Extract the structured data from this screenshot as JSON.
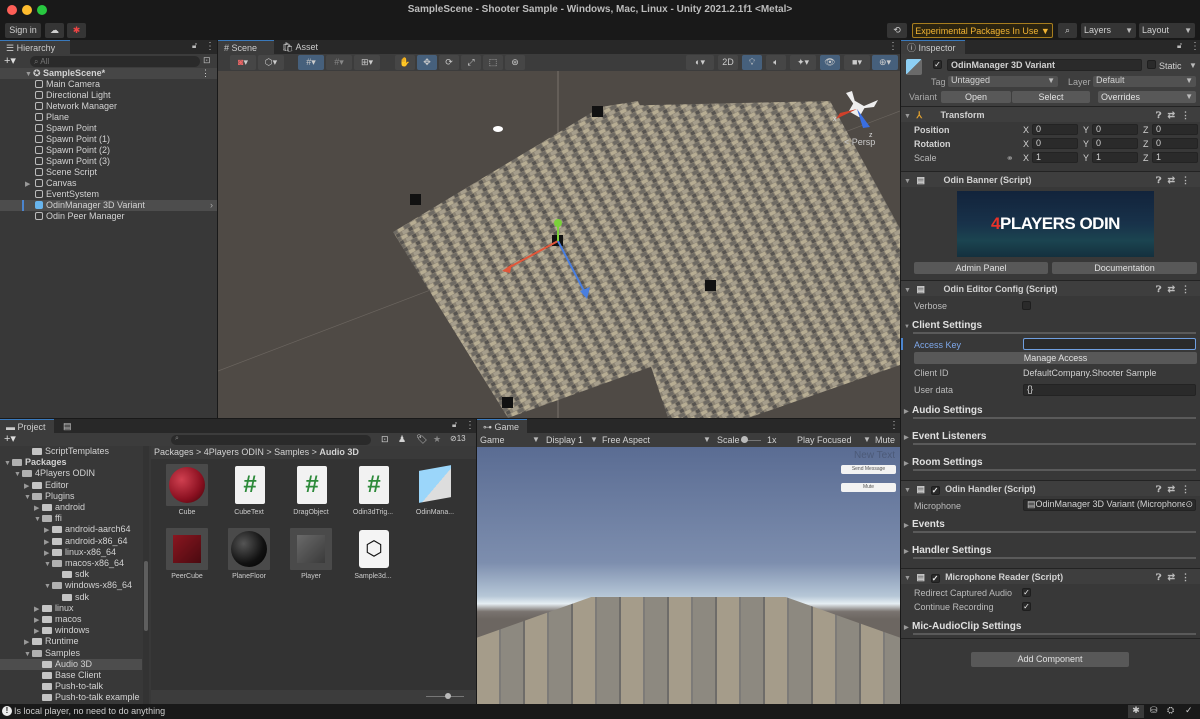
{
  "window": {
    "title": "SampleScene - Shooter Sample - Windows, Mac, Linux - Unity 2021.2.1f1 <Metal>"
  },
  "toolbar": {
    "sign_in": "Sign in",
    "cloud_icon": "cloud-icon",
    "collab_icon": "collab-icon",
    "play_icon": "▶",
    "pause_icon": "❚❚",
    "step_icon": "▶|",
    "history_icon": "history-icon",
    "experimental": "Experimental Packages In Use ▼",
    "search_icon": "search-icon",
    "layers": "Layers",
    "layout": "Layout"
  },
  "hierarchy": {
    "tab": "Hierarchy",
    "search_placeholder": "All",
    "scene": "SampleScene*",
    "items": [
      {
        "label": "Main Camera",
        "expandable": false
      },
      {
        "label": "Directional Light",
        "expandable": false
      },
      {
        "label": "Network Manager",
        "expandable": false
      },
      {
        "label": "Plane",
        "expandable": false
      },
      {
        "label": "Spawn Point",
        "expandable": false
      },
      {
        "label": "Spawn Point (1)",
        "expandable": false
      },
      {
        "label": "Spawn Point (2)",
        "expandable": false
      },
      {
        "label": "Spawn Point (3)",
        "expandable": false
      },
      {
        "label": "Scene Script",
        "expandable": false
      },
      {
        "label": "Canvas",
        "expandable": true
      },
      {
        "label": "EventSystem",
        "expandable": false
      },
      {
        "label": "OdinManager 3D Variant",
        "expandable": false,
        "selected": true,
        "prefab": true
      },
      {
        "label": "Odin Peer Manager",
        "expandable": false
      }
    ]
  },
  "scene": {
    "tabs": [
      "Scene",
      "Asset Store"
    ],
    "btn_2d": "2D",
    "gizmo_x": "x",
    "gizmo_z": "z",
    "persp": "< Persp"
  },
  "inspector": {
    "tab": "Inspector",
    "object_name": "OdinManager 3D Variant",
    "static_label": "Static",
    "tag_label": "Tag",
    "tag_value": "Untagged",
    "layer_label": "Layer",
    "layer_value": "Default",
    "variant_label": "Variant",
    "open": "Open",
    "select": "Select",
    "overrides": "Overrides",
    "transform": {
      "title": "Transform",
      "rows": [
        {
          "label": "Position",
          "x": "0",
          "y": "0",
          "z": "0"
        },
        {
          "label": "Rotation",
          "x": "0",
          "y": "0",
          "z": "0"
        },
        {
          "label": "Scale",
          "x": "1",
          "y": "1",
          "z": "1"
        }
      ]
    },
    "banner": {
      "title": "Odin Banner (Script)",
      "logo_accent": "4",
      "logo_text": "PLAYERS ODIN",
      "admin_panel": "Admin Panel",
      "documentation": "Documentation"
    },
    "editor_config": {
      "title": "Odin Editor Config (Script)",
      "verbose": "Verbose",
      "client_settings": "Client Settings",
      "access_key": "Access Key",
      "access_key_value": "",
      "manage_access": "Manage Access",
      "client_id_label": "Client ID",
      "client_id_value": "DefaultCompany.Shooter Sample",
      "user_data_label": "User data",
      "user_data_value": "{}",
      "audio_settings": "Audio Settings",
      "event_listeners": "Event Listeners",
      "room_settings": "Room Settings"
    },
    "handler": {
      "title": "Odin Handler (Script)",
      "microphone_label": "Microphone",
      "microphone_value": "OdinManager 3D Variant (Microphone I",
      "events": "Events",
      "handler_settings": "Handler Settings"
    },
    "mic_reader": {
      "title": "Microphone Reader (Script)",
      "redirect": "Redirect Captured Audio",
      "redirect_checked": true,
      "continue": "Continue Recording",
      "continue_checked": true,
      "clip_settings": "Mic-AudioClip Settings"
    },
    "add_component": "Add Component"
  },
  "project": {
    "tabs": [
      "Project",
      "Console"
    ],
    "hidden_count": "13",
    "breadcrumb": [
      "Packages",
      "4Players ODIN",
      "Samples",
      "Audio 3D"
    ],
    "tree": [
      {
        "label": "ScriptTemplates",
        "depth": 2,
        "arrow": "",
        "open": false
      },
      {
        "label": "Packages",
        "depth": 0,
        "arrow": "▼",
        "open": true,
        "bold": true
      },
      {
        "label": "4Players ODIN",
        "depth": 1,
        "arrow": "▼",
        "open": true
      },
      {
        "label": "Editor",
        "depth": 2,
        "arrow": "▶",
        "open": false
      },
      {
        "label": "Plugins",
        "depth": 2,
        "arrow": "▼",
        "open": true
      },
      {
        "label": "android",
        "depth": 3,
        "arrow": "▶",
        "open": false
      },
      {
        "label": "ffi",
        "depth": 3,
        "arrow": "▼",
        "open": true
      },
      {
        "label": "android-aarch64",
        "depth": 4,
        "arrow": "▶",
        "open": false
      },
      {
        "label": "android-x86_64",
        "depth": 4,
        "arrow": "▶",
        "open": false
      },
      {
        "label": "linux-x86_64",
        "depth": 4,
        "arrow": "▶",
        "open": false
      },
      {
        "label": "macos-x86_64",
        "depth": 4,
        "arrow": "▼",
        "open": true
      },
      {
        "label": "sdk",
        "depth": 5,
        "arrow": "",
        "open": false
      },
      {
        "label": "windows-x86_64",
        "depth": 4,
        "arrow": "▼",
        "open": true
      },
      {
        "label": "sdk",
        "depth": 5,
        "arrow": "",
        "open": false
      },
      {
        "label": "linux",
        "depth": 3,
        "arrow": "▶",
        "open": false
      },
      {
        "label": "macos",
        "depth": 3,
        "arrow": "▶",
        "open": false
      },
      {
        "label": "windows",
        "depth": 3,
        "arrow": "▶",
        "open": false
      },
      {
        "label": "Runtime",
        "depth": 2,
        "arrow": "▶",
        "open": false
      },
      {
        "label": "Samples",
        "depth": 2,
        "arrow": "▼",
        "open": true
      },
      {
        "label": "Audio 3D",
        "depth": 3,
        "arrow": "",
        "open": false,
        "selected": true
      },
      {
        "label": "Base Client",
        "depth": 3,
        "arrow": "",
        "open": false
      },
      {
        "label": "Push-to-talk",
        "depth": 3,
        "arrow": "",
        "open": false
      },
      {
        "label": "Push-to-talk example",
        "depth": 3,
        "arrow": "",
        "open": false
      }
    ],
    "assets": [
      {
        "label": "Cube",
        "kind": "red-sphere"
      },
      {
        "label": "CubeText",
        "kind": "script"
      },
      {
        "label": "DragObject",
        "kind": "script"
      },
      {
        "label": "Odin3dTrig...",
        "kind": "script"
      },
      {
        "label": "OdinMana...",
        "kind": "prefab"
      },
      {
        "label": "PeerCube",
        "kind": "red-cube"
      },
      {
        "label": "PlaneFloor",
        "kind": "black-sphere"
      },
      {
        "label": "Player",
        "kind": "grey-cube"
      },
      {
        "label": "Sample3d...",
        "kind": "scene"
      }
    ]
  },
  "game": {
    "tab": "Game",
    "mode": "Game",
    "display": "Display 1",
    "aspect": "Free Aspect",
    "scale_label": "Scale",
    "scale_value": "1x",
    "play_focused": "Play Focused",
    "mute": "Mute A",
    "new_text": "New Text",
    "send_message": "Send Message",
    "mute_button": "Mute"
  },
  "status": {
    "message": "Is local player, no need to do anything"
  }
}
